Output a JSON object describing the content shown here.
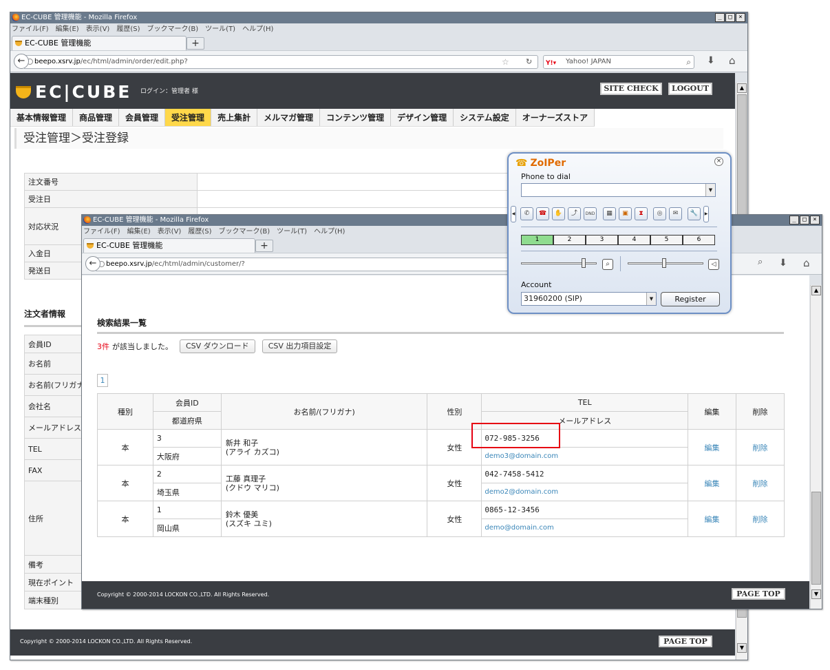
{
  "main_window": {
    "title": "EC-CUBE 管理機能 - Mozilla Firefox",
    "menu": [
      "ファイル(F)",
      "編集(E)",
      "表示(V)",
      "履歴(S)",
      "ブックマーク(B)",
      "ツール(T)",
      "ヘルプ(H)"
    ],
    "tab_label": "EC-CUBE 管理機能",
    "url_host": "beepo.xsrv.jp",
    "url_path": "/ec/html/admin/order/edit.php?",
    "search_engine": "Yahoo! JAPAN",
    "logo_text": "EC|CUBE",
    "login_text": "ログイン：管理者 様",
    "site_check": "SITE CHECK",
    "logout": "LOGOUT",
    "global_nav": [
      "基本情報管理",
      "商品管理",
      "会員管理",
      "受注管理",
      "売上集計",
      "メルマガ管理",
      "コンテンツ管理",
      "デザイン管理",
      "システム設定",
      "オーナーズストア"
    ],
    "active_nav": "受注管理",
    "page_heading": "受注管理＞受注登録",
    "order_rows": [
      "注文番号",
      "受注日",
      "対応状況",
      "入金日",
      "発送日"
    ],
    "orderer_heading": "注文者情報",
    "orderer_rows": [
      "会員ID",
      "お名前",
      "お名前(フリガナ)",
      "会社名",
      "メールアドレス",
      "TEL",
      "FAX",
      "住所",
      "備考",
      "現在ポイント",
      "端末種別"
    ],
    "copyright": "Copyright © 2000-2014 LOCKON CO.,LTD. All Rights Reserved.",
    "page_top": "PAGE TOP"
  },
  "popup_window": {
    "title": "EC-CUBE 管理機能 - Mozilla Firefox",
    "menu": [
      "ファイル(F)",
      "編集(E)",
      "表示(V)",
      "履歴(S)",
      "ブックマーク(B)",
      "ツール(T)",
      "ヘルプ(H)"
    ],
    "tab_label": "EC-CUBE 管理機能",
    "url_host": "beepo.xsrv.jp",
    "url_path": "/ec/html/admin/customer/?",
    "results_heading": "検索結果一覧",
    "count": "3件",
    "count_suffix": "が該当しました。",
    "csv_download": "CSV ダウンロード",
    "csv_settings": "CSV 出力項目設定",
    "page_number": "1",
    "table_headers": {
      "type": "種別",
      "member_id": "会員ID",
      "prefecture": "都道府県",
      "name": "お名前/(フリガナ)",
      "gender": "性別",
      "tel": "TEL",
      "email": "メールアドレス",
      "edit": "編集",
      "delete": "削除"
    },
    "rows": [
      {
        "type": "本",
        "id": "3",
        "pref": "大阪府",
        "name": "新井 和子",
        "kana": "(アライ カズコ)",
        "gender": "女性",
        "tel": "072-985-3256",
        "email": "demo3@domain.com",
        "edit": "編集",
        "delete": "削除"
      },
      {
        "type": "本",
        "id": "2",
        "pref": "埼玉県",
        "name": "工藤 真理子",
        "kana": "(クドウ マリコ)",
        "gender": "女性",
        "tel": "042-7458-5412",
        "email": "demo2@domain.com",
        "edit": "編集",
        "delete": "削除"
      },
      {
        "type": "本",
        "id": "1",
        "pref": "岡山県",
        "name": "鈴木 優美",
        "kana": "(スズキ ユミ)",
        "gender": "女性",
        "tel": "0865-12-3456",
        "email": "demo@domain.com",
        "edit": "編集",
        "delete": "削除"
      }
    ],
    "copyright": "Copyright © 2000-2014 LOCKON CO.,LTD. All Rights Reserved.",
    "page_top": "PAGE TOP"
  },
  "zoiper": {
    "logo": "ZoIPer",
    "phone_label": "Phone to dial",
    "phone_value": "",
    "line_tabs": [
      "1",
      "2",
      "3",
      "4",
      "5",
      "6"
    ],
    "active_line": "1",
    "account_label": "Account",
    "account_value": "31960200 (SIP)",
    "register": "Register",
    "speaker_level": 0.8,
    "mic_level": 0.45
  },
  "colors": {
    "titlebar": "#6a7a8c",
    "header_bg": "#3a3d42",
    "nav_active": "#ffd84a",
    "count_red": "#e60012",
    "link_blue": "#3a86b8",
    "highlight_red": "#e60012"
  }
}
